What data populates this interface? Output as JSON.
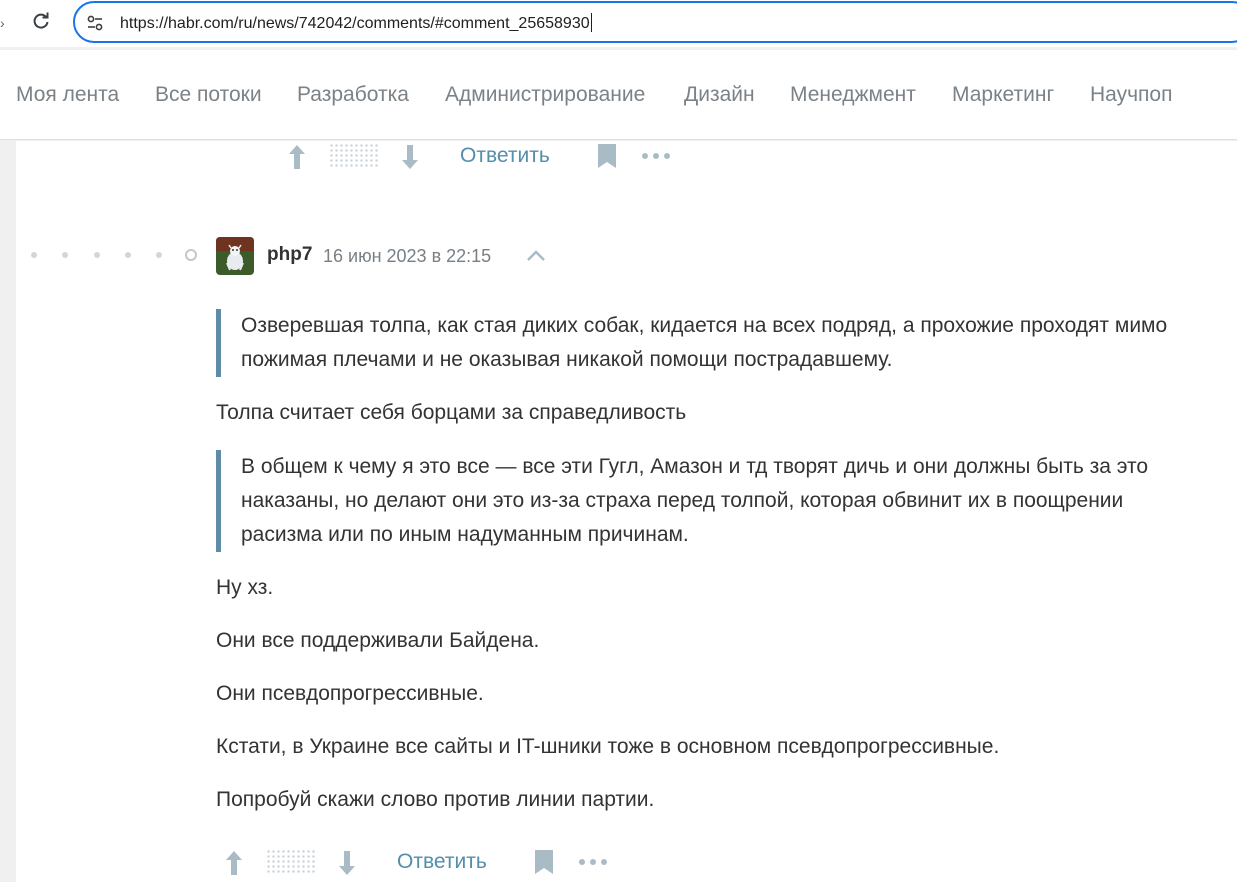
{
  "browser": {
    "url": "https://habr.com/ru/news/742042/comments/#comment_25658930"
  },
  "nav": {
    "items": [
      {
        "label": "Моя лента"
      },
      {
        "label": "Все потоки"
      },
      {
        "label": "Разработка"
      },
      {
        "label": "Администрирование"
      },
      {
        "label": "Дизайн"
      },
      {
        "label": "Менеджмент"
      },
      {
        "label": "Маркетинг"
      },
      {
        "label": "Научпоп"
      }
    ]
  },
  "prev_comment": {
    "reply_label": "Ответить"
  },
  "comment": {
    "author": "php7",
    "timestamp": "16 июн 2023 в 22:15",
    "quote1": "Озверевшая толпа, как стая диких собак, кидается на всех подряд, а прохожие проходят мимо пожимая плечами и не оказывая никакой помощи пострадавшему.",
    "para1": "Толпа считает себя борцами за справедливость",
    "quote2": "В общем к чему я это все — все эти Гугл, Амазон и тд творят дичь и они должны быть за это наказаны, но делают они это из-за страха перед толпой, которая обвинит их в поощрении расизма или по иным надуманным причинам.",
    "para2": "Ну хз.",
    "para3": "Они все поддерживали Байдена.",
    "para4": "Они псевдопрогрессивные.",
    "para5": "Кстати, в Украине все сайты и IT-шники тоже в основном псевдопрогрессивные.",
    "para6": "Попробуй скажи слово против линии партии.",
    "reply_label": "Ответить"
  },
  "colors": {
    "url_focus": "#1a73e8",
    "link": "#548eaa",
    "quote_bar": "#5e8ca7",
    "nav_text": "#7b8287",
    "icon_gray": "#9fb1bb"
  }
}
